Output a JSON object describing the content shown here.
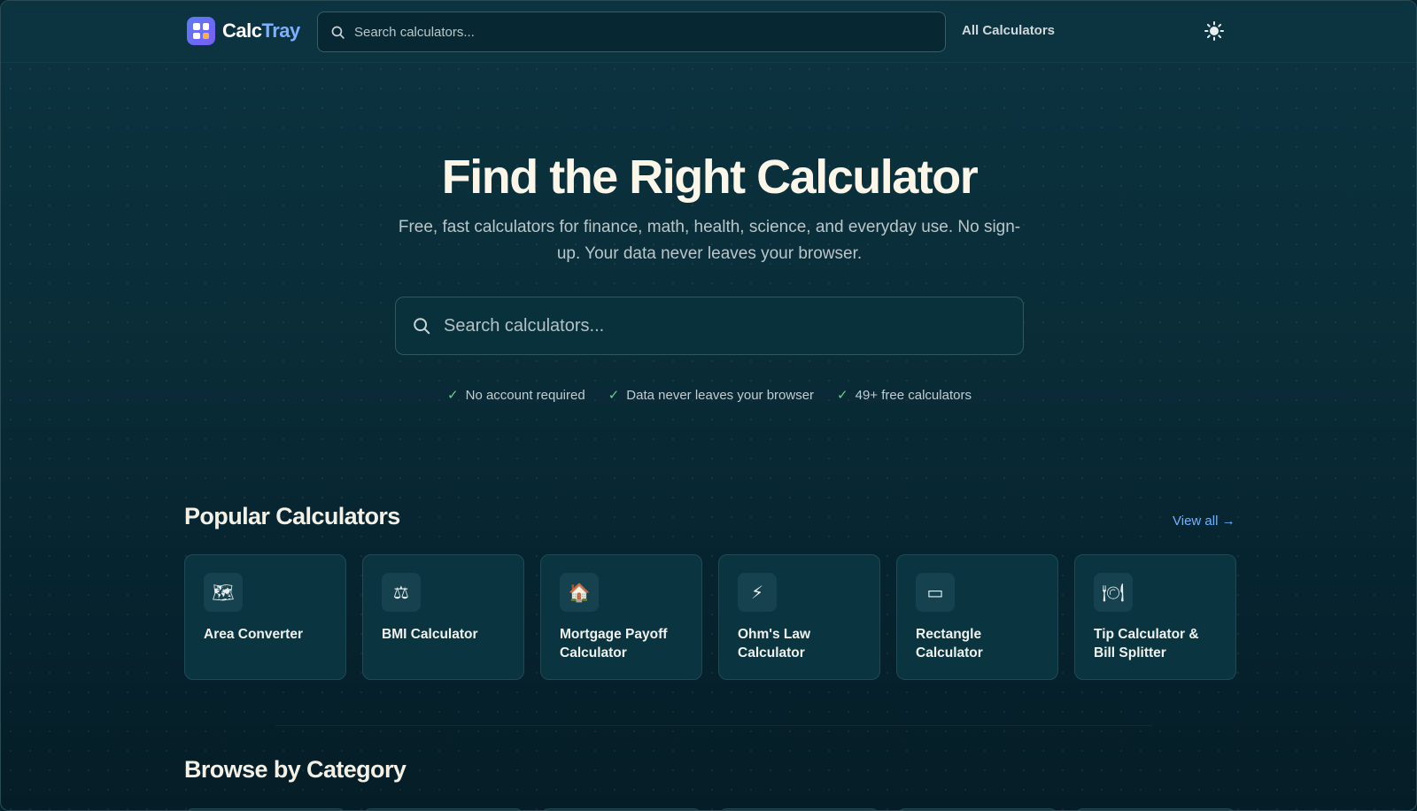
{
  "header": {
    "brand_part1": "Calc",
    "brand_part2": "Tray",
    "search_placeholder": "Search calculators...",
    "nav_all": "All Calculators",
    "theme_icon": "sun-icon"
  },
  "hero": {
    "title": "Find the Right Calculator",
    "subtitle": "Free, fast calculators for finance, math, health, science, and everyday use. No sign-up. Your data never leaves your browser.",
    "search_placeholder": "Search calculators...",
    "features": [
      {
        "label": "No account required"
      },
      {
        "label": "Data never leaves your browser"
      },
      {
        "label": "49+ free calculators"
      }
    ]
  },
  "popular": {
    "title": "Popular Calculators",
    "view_all": "View all →",
    "cards": [
      {
        "label": "Area Converter",
        "icon": "🗺"
      },
      {
        "label": "BMI Calculator",
        "icon": "⚖"
      },
      {
        "label": "Mortgage Payoff Calculator",
        "icon": "🏠"
      },
      {
        "label": "Ohm's Law Calculator",
        "icon": "⚡"
      },
      {
        "label": "Rectangle Calculator",
        "icon": "▭"
      },
      {
        "label": "Tip Calculator & Bill Splitter",
        "icon": "🍽"
      }
    ]
  },
  "browse": {
    "title": "Browse by Category"
  },
  "colors": {
    "background": "#0a2d38",
    "accent": "#6fb3ff",
    "check": "#6bd08a",
    "title": "#fbf6e8"
  }
}
